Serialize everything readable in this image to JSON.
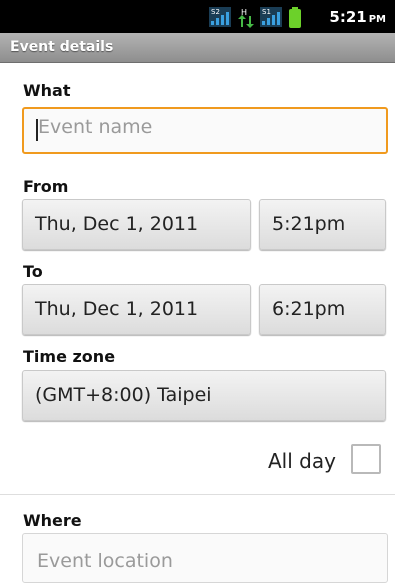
{
  "status_bar": {
    "time": "5:21",
    "ampm": "PM",
    "signal1_label": "S2",
    "signal2_label": "S1",
    "data_label": "H",
    "icons": [
      "signal-icon",
      "data-transfer-icon",
      "signal-icon",
      "battery-icon"
    ],
    "colors": {
      "signal": "#3aa0e0",
      "data": "#46b946",
      "battery": "#6cd12a"
    }
  },
  "title": "Event details",
  "what": {
    "label": "What",
    "placeholder": "Event name"
  },
  "from": {
    "label": "From",
    "date": "Thu, Dec 1, 2011",
    "time": "5:21pm"
  },
  "to": {
    "label": "To",
    "date": "Thu, Dec 1, 2011",
    "time": "6:21pm"
  },
  "timezone": {
    "label": "Time zone",
    "value": "(GMT+8:00) Taipei"
  },
  "all_day": {
    "label": "All day",
    "checked": false
  },
  "where": {
    "label": "Where",
    "placeholder": "Event location"
  },
  "accent_color": "#f09a1e"
}
